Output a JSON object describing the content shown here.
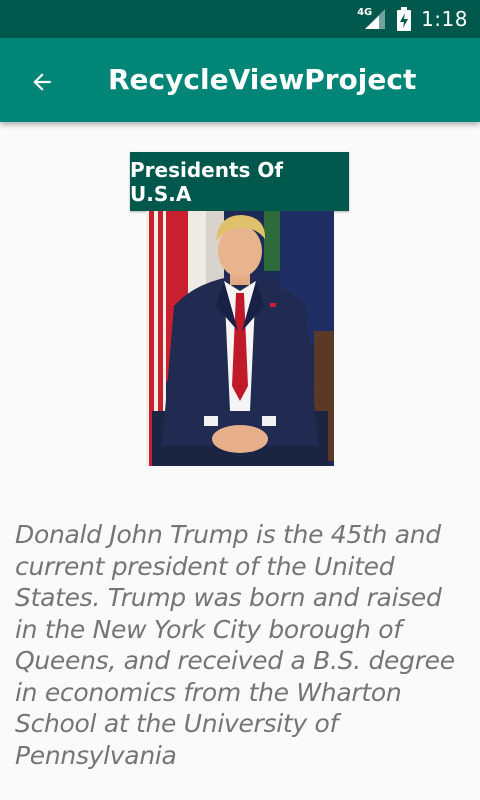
{
  "status_bar": {
    "network_type": "4G",
    "time": "1:18"
  },
  "app_bar": {
    "title": "RecycleViewProject"
  },
  "header_button": {
    "label": "Presidents Of U.S.A"
  },
  "description": {
    "text": "Donald John Trump is the 45th and current president of the United States. Trump was born and raised in the New York City borough of Queens, and received a B.S. degree in economics from the Wharton School at the University of Pennsylvania"
  },
  "colors": {
    "status_bar": "#00574b",
    "app_bar": "#008577",
    "header_button": "#00574b",
    "description_text": "#757575",
    "background": "#fafafa"
  },
  "icons": {
    "back": "arrow-back",
    "signal": "cellular-signal",
    "battery": "battery-charging"
  }
}
